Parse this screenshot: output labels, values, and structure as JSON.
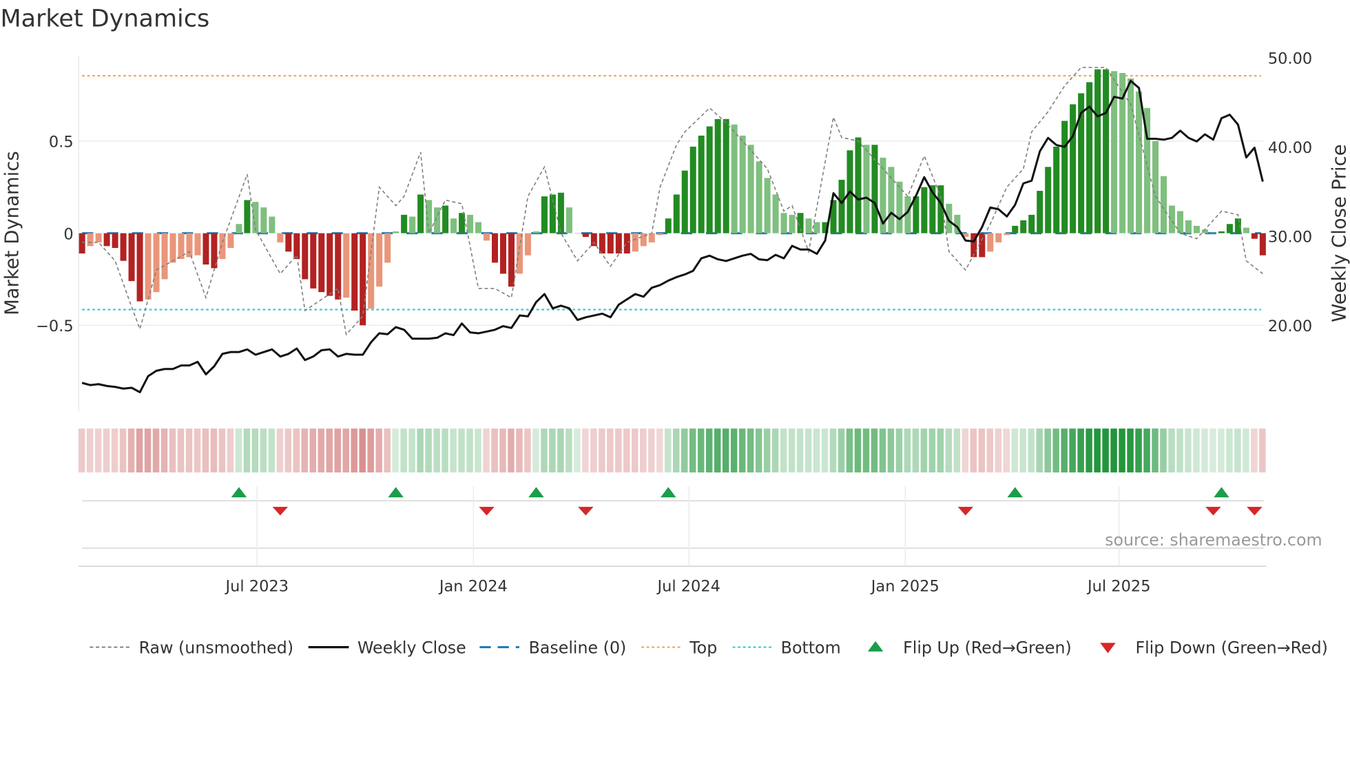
{
  "title": "Market Dynamics",
  "source": "source: sharemaestro.com",
  "chart_data": {
    "type": "bar",
    "title": "Market Dynamics",
    "ylabel": "Market Dynamics",
    "y2label": "Weekly Close Price",
    "ylim": [
      -0.97,
      0.97
    ],
    "y2lim": [
      11.5,
      50.0
    ],
    "left_ticks": [
      {
        "v": 0.5,
        "label": "0.5"
      },
      {
        "v": 0,
        "label": "0"
      },
      {
        "v": -0.5,
        "label": "−0.5"
      }
    ],
    "right_ticks": [
      {
        "v": 50,
        "label": "50.00"
      },
      {
        "v": 40,
        "label": "40.00"
      },
      {
        "v": 30,
        "label": "30.00"
      },
      {
        "v": 20,
        "label": "20.00"
      }
    ],
    "x_ticks": [
      {
        "week": 21.2,
        "label": "Jul 2023"
      },
      {
        "week": 47.4,
        "label": "Jan 2024"
      },
      {
        "week": 73.5,
        "label": "Jul 2024"
      },
      {
        "week": 99.7,
        "label": "Jan 2025"
      },
      {
        "week": 125.6,
        "label": "Jul 2025"
      }
    ],
    "top_level": 0.855,
    "bottom_level": -0.415,
    "baseline": 0,
    "dynamics": [
      -0.11,
      -0.07,
      -0.05,
      -0.07,
      -0.08,
      -0.15,
      -0.26,
      -0.37,
      -0.36,
      -0.32,
      -0.25,
      -0.16,
      -0.14,
      -0.13,
      -0.12,
      -0.17,
      -0.19,
      -0.14,
      -0.08,
      0.05,
      0.18,
      0.17,
      0.14,
      0.09,
      -0.05,
      -0.1,
      -0.14,
      -0.25,
      -0.3,
      -0.32,
      -0.34,
      -0.36,
      -0.35,
      -0.42,
      -0.5,
      -0.41,
      -0.29,
      -0.16,
      0.01,
      0.1,
      0.09,
      0.21,
      0.18,
      0.14,
      0.15,
      0.08,
      0.11,
      0.1,
      0.06,
      -0.04,
      -0.16,
      -0.22,
      -0.29,
      -0.22,
      -0.12,
      0.01,
      0.2,
      0.21,
      0.22,
      0.14,
      0.0,
      -0.02,
      -0.07,
      -0.11,
      -0.11,
      -0.11,
      -0.11,
      -0.1,
      -0.07,
      -0.05,
      -0.01,
      0.08,
      0.21,
      0.34,
      0.47,
      0.53,
      0.58,
      0.62,
      0.62,
      0.59,
      0.53,
      0.48,
      0.39,
      0.3,
      0.21,
      0.11,
      0.1,
      0.11,
      0.08,
      0.06,
      0.06,
      0.18,
      0.29,
      0.45,
      0.52,
      0.48,
      0.48,
      0.41,
      0.36,
      0.28,
      0.2,
      0.2,
      0.25,
      0.26,
      0.26,
      0.16,
      0.1,
      -0.02,
      -0.13,
      -0.13,
      -0.1,
      -0.05,
      -0.01,
      0.04,
      0.07,
      0.1,
      0.23,
      0.36,
      0.47,
      0.61,
      0.7,
      0.76,
      0.82,
      0.89,
      0.89,
      0.88,
      0.87,
      0.84,
      0.77,
      0.68,
      0.5,
      0.31,
      0.15,
      0.12,
      0.07,
      0.04,
      0.02,
      0.0,
      0.01,
      0.05,
      0.08,
      0.03,
      -0.03,
      -0.12
    ],
    "weekly_close": [
      13.55,
      13.3,
      13.4,
      13.2,
      13.1,
      12.9,
      13.0,
      12.5,
      14.3,
      14.9,
      15.1,
      15.1,
      15.5,
      15.5,
      15.9,
      14.5,
      15.4,
      16.8,
      17.0,
      17.0,
      17.3,
      16.7,
      17.0,
      17.3,
      16.5,
      16.8,
      17.4,
      16.1,
      16.5,
      17.2,
      17.3,
      16.5,
      16.8,
      16.7,
      16.7,
      18.1,
      19.1,
      19.0,
      19.8,
      19.5,
      18.5,
      18.5,
      18.5,
      18.6,
      19.1,
      18.9,
      20.2,
      19.2,
      19.1,
      19.3,
      19.5,
      19.9,
      19.7,
      21.1,
      21.0,
      22.6,
      23.5,
      21.9,
      22.2,
      21.9,
      20.6,
      20.9,
      21.1,
      21.3,
      20.9,
      22.3,
      22.9,
      23.5,
      23.2,
      24.2,
      24.5,
      25.0,
      25.4,
      25.7,
      26.1,
      27.5,
      27.8,
      27.4,
      27.2,
      27.5,
      27.8,
      28.0,
      27.4,
      27.3,
      27.9,
      27.5,
      28.9,
      28.5,
      28.5,
      28.0,
      29.5,
      34.8,
      33.7,
      35.0,
      34.1,
      34.3,
      33.7,
      31.4,
      32.6,
      31.9,
      32.7,
      34.5,
      36.6,
      34.9,
      33.7,
      31.7,
      31.0,
      29.5,
      29.4,
      31.0,
      33.2,
      33.0,
      32.2,
      33.5,
      35.9,
      36.2,
      39.5,
      41.0,
      40.2,
      40.0,
      41.2,
      43.8,
      44.5,
      43.4,
      43.8,
      45.6,
      45.4,
      47.4,
      46.6,
      40.9,
      40.9,
      40.8,
      41.0,
      41.8,
      41.0,
      40.6,
      41.4,
      40.8,
      43.2,
      43.6,
      42.5,
      38.8,
      39.9,
      36.1
    ],
    "raw_unsmoothed": [
      [
        0,
        -0.05
      ],
      [
        2,
        -0.05
      ],
      [
        4,
        -0.15
      ],
      [
        6,
        -0.4
      ],
      [
        7,
        -0.52
      ],
      [
        9,
        -0.2
      ],
      [
        11,
        -0.15
      ],
      [
        13,
        -0.1
      ],
      [
        15,
        -0.35
      ],
      [
        17,
        -0.05
      ],
      [
        20,
        0.32
      ],
      [
        21,
        0.02
      ],
      [
        24,
        -0.22
      ],
      [
        26,
        -0.12
      ],
      [
        27,
        -0.42
      ],
      [
        31,
        -0.3
      ],
      [
        32,
        -0.55
      ],
      [
        34,
        -0.45
      ],
      [
        36,
        0.25
      ],
      [
        38,
        0.15
      ],
      [
        39,
        0.2
      ],
      [
        41,
        0.44
      ],
      [
        42,
        0.0
      ],
      [
        44,
        0.18
      ],
      [
        46,
        0.16
      ],
      [
        48,
        -0.3
      ],
      [
        50,
        -0.3
      ],
      [
        52,
        -0.35
      ],
      [
        54,
        0.2
      ],
      [
        56,
        0.36
      ],
      [
        58,
        0.0
      ],
      [
        60,
        -0.15
      ],
      [
        62,
        -0.05
      ],
      [
        64,
        -0.18
      ],
      [
        66,
        -0.05
      ],
      [
        69,
        0.0
      ],
      [
        70,
        0.25
      ],
      [
        72,
        0.48
      ],
      [
        73,
        0.55
      ],
      [
        76,
        0.68
      ],
      [
        78,
        0.6
      ],
      [
        80,
        0.5
      ],
      [
        83,
        0.35
      ],
      [
        85,
        0.12
      ],
      [
        86,
        0.15
      ],
      [
        88,
        -0.1
      ],
      [
        91,
        0.63
      ],
      [
        92,
        0.52
      ],
      [
        94,
        0.5
      ],
      [
        97,
        0.35
      ],
      [
        100,
        0.2
      ],
      [
        102,
        0.42
      ],
      [
        104,
        0.2
      ],
      [
        105,
        -0.1
      ],
      [
        107,
        -0.2
      ],
      [
        110,
        0.05
      ],
      [
        112,
        0.25
      ],
      [
        114,
        0.35
      ],
      [
        115,
        0.55
      ],
      [
        117,
        0.66
      ],
      [
        119,
        0.8
      ],
      [
        121,
        0.9
      ],
      [
        124,
        0.9
      ],
      [
        127,
        0.7
      ],
      [
        130,
        0.2
      ],
      [
        133,
        0.0
      ],
      [
        135,
        -0.03
      ],
      [
        138,
        0.12
      ],
      [
        140,
        0.1
      ],
      [
        141,
        -0.15
      ],
      [
        143,
        -0.22
      ]
    ],
    "flip_up_weeks": [
      19,
      38,
      55,
      71,
      113,
      138
    ],
    "flip_down_weeks": [
      24,
      49,
      61,
      107,
      137,
      142
    ],
    "legend": {
      "placement": "bottom",
      "items": [
        "Raw (unsmoothed)",
        "Weekly Close",
        "Baseline (0)",
        "Top",
        "Bottom",
        "Flip Up (Red→Green)",
        "Flip Down (Green→Red)"
      ]
    },
    "colors": {
      "green_strong": "#228b22",
      "green_weak": "#7fbf7f",
      "red_strong": "#b22222",
      "red_weak": "#e9967a",
      "baseline": "#1f77b4",
      "top": "#f4a460",
      "bottom": "#3cc8dc",
      "close": "#111111",
      "raw": "#808080",
      "flip_up": "#1a9e4a",
      "flip_down": "#d62728"
    }
  }
}
